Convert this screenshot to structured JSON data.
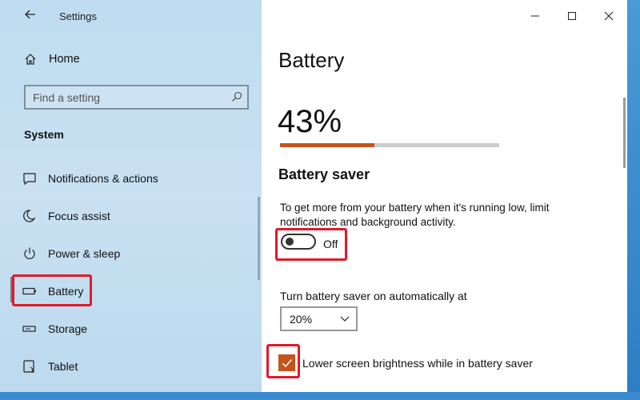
{
  "window": {
    "title": "Settings"
  },
  "sidebar": {
    "home_label": "Home",
    "search_placeholder": "Find a setting",
    "section_label": "System",
    "items": [
      {
        "label": "Notifications & actions",
        "icon": "notification-icon"
      },
      {
        "label": "Focus assist",
        "icon": "moon-icon"
      },
      {
        "label": "Power & sleep",
        "icon": "power-icon"
      },
      {
        "label": "Battery",
        "icon": "battery-icon",
        "selected": true
      },
      {
        "label": "Storage",
        "icon": "storage-icon"
      },
      {
        "label": "Tablet",
        "icon": "tablet-icon"
      }
    ]
  },
  "main": {
    "page_title": "Battery",
    "battery_percent": "43%",
    "battery_level": 0.43,
    "saver_title": "Battery saver",
    "saver_description": "To get more from your battery when it's running low, limit notifications and background activity.",
    "toggle_state": "Off",
    "auto_label": "Turn battery saver on automatically at",
    "auto_value": "20%",
    "brightness_label": "Lower screen brightness while in battery saver",
    "brightness_checked": true
  },
  "colors": {
    "accent": "#c4541c",
    "highlight": "#e0192c"
  }
}
